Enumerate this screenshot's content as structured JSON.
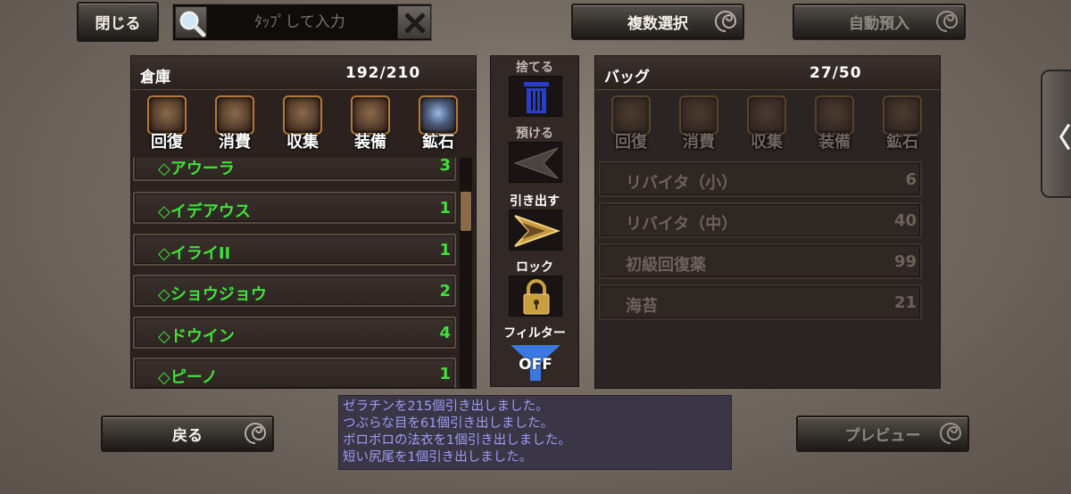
{
  "top": {
    "close_label": "閉じる",
    "search_placeholder": "ﾀｯﾌﾟして入力",
    "multi_select_label": "複数選択",
    "auto_deposit_label": "自動預入"
  },
  "warehouse": {
    "title": "倉庫",
    "count": "192/210",
    "categories": [
      "回復",
      "消費",
      "収集",
      "装備",
      "鉱石"
    ],
    "items": [
      {
        "name": "◇アウーラ",
        "qty": "3"
      },
      {
        "name": "◇イデアウス",
        "qty": "1"
      },
      {
        "name": "◇イライII",
        "qty": "1"
      },
      {
        "name": "◇ショウジョウ",
        "qty": "2"
      },
      {
        "name": "◇ドウイン",
        "qty": "4"
      },
      {
        "name": "◇ピーノ",
        "qty": "1"
      }
    ]
  },
  "actions": {
    "discard_label": "捨てる",
    "deposit_label": "預ける",
    "withdraw_label": "引き出す",
    "lock_label": "ロック",
    "filter_label": "フィルター",
    "filter_state": "OFF"
  },
  "bag": {
    "title": "バッグ",
    "count": "27/50",
    "categories": [
      "回復",
      "消費",
      "収集",
      "装備",
      "鉱石"
    ],
    "items": [
      {
        "name": "リバイタ（小）",
        "qty": "6"
      },
      {
        "name": "リバイタ（中）",
        "qty": "40"
      },
      {
        "name": "初級回復薬",
        "qty": "99"
      },
      {
        "name": "海苔",
        "qty": "21"
      }
    ]
  },
  "log": [
    "ゼラチンを215個引き出しました。",
    "つぶらな目を61個引き出しました。",
    "ボロボロの法衣を1個引き出しました。",
    "短い尻尾を1個引き出しました。"
  ],
  "bottom": {
    "back_label": "戻る",
    "preview_label": "プレビュー"
  },
  "side_tab_glyph": "〈",
  "colors": {
    "item_text": "#3fe23a",
    "log_text": "#9d9cf4",
    "panel_bg": "#2b2220",
    "accent_border": "#b07a3c"
  }
}
